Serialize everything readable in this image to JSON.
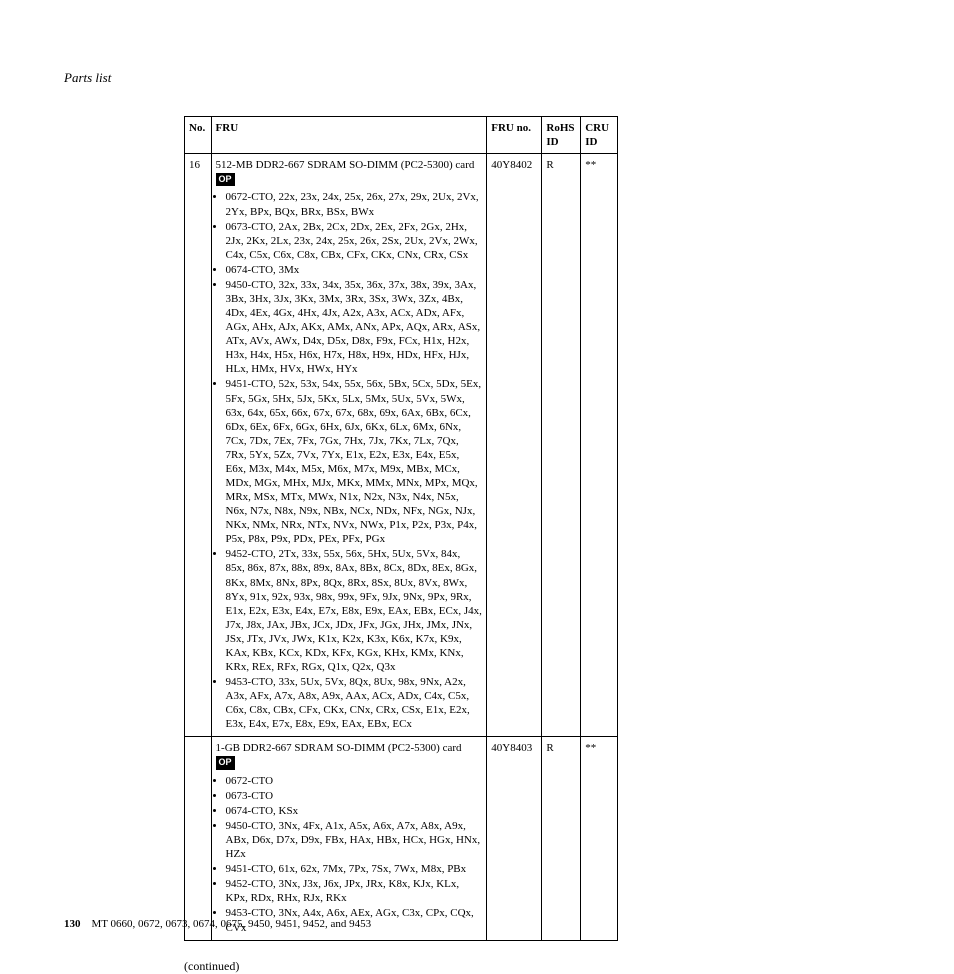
{
  "header": "Parts list",
  "columns": {
    "no": "No.",
    "fru": "FRU",
    "fruno_l1": "FRU no.",
    "rohs_l1": "RoHS",
    "rohs_l2": "ID",
    "cru_l1": "CRU",
    "cru_l2": "ID"
  },
  "rows": [
    {
      "no": "16",
      "title": "512-MB DDR2-667 SDRAM SO-DIMM (PC2-5300) card",
      "op": "OP",
      "bullets": [
        "0672-CTO, 22x, 23x, 24x, 25x, 26x, 27x, 29x, 2Ux, 2Vx, 2Yx, BPx, BQx, BRx, BSx, BWx",
        "0673-CTO, 2Ax, 2Bx, 2Cx, 2Dx, 2Ex, 2Fx, 2Gx, 2Hx, 2Jx, 2Kx, 2Lx, 23x, 24x, 25x, 26x, 2Sx, 2Ux, 2Vx, 2Wx, C4x, C5x, C6x, C8x, CBx, CFx, CKx, CNx, CRx, CSx",
        "0674-CTO, 3Mx",
        "9450-CTO, 32x, 33x, 34x, 35x, 36x, 37x, 38x, 39x, 3Ax, 3Bx, 3Hx, 3Jx, 3Kx, 3Mx, 3Rx, 3Sx, 3Wx, 3Zx, 4Bx, 4Dx, 4Ex, 4Gx, 4Hx, 4Jx, A2x, A3x, ACx, ADx, AFx, AGx, AHx, AJx, AKx, AMx, ANx, APx, AQx, ARx, ASx, ATx, AVx, AWx, D4x, D5x, D8x, F9x, FCx, H1x, H2x, H3x, H4x, H5x, H6x, H7x, H8x, H9x, HDx, HFx, HJx, HLx, HMx, HVx, HWx, HYx",
        "9451-CTO, 52x, 53x, 54x, 55x, 56x, 5Bx, 5Cx, 5Dx, 5Ex, 5Fx, 5Gx, 5Hx, 5Jx, 5Kx, 5Lx, 5Mx, 5Ux, 5Vx, 5Wx, 63x, 64x, 65x, 66x, 67x, 67x, 68x, 69x, 6Ax, 6Bx, 6Cx, 6Dx, 6Ex, 6Fx, 6Gx, 6Hx, 6Jx, 6Kx, 6Lx, 6Mx, 6Nx, 7Cx, 7Dx, 7Ex, 7Fx, 7Gx, 7Hx, 7Jx, 7Kx, 7Lx, 7Qx, 7Rx, 5Yx, 5Zx, 7Vx, 7Yx, E1x, E2x, E3x, E4x, E5x, E6x, M3x, M4x, M5x, M6x, M7x, M9x, MBx, MCx, MDx, MGx, MHx, MJx, MKx, MMx, MNx, MPx, MQx, MRx, MSx, MTx, MWx, N1x, N2x, N3x, N4x, N5x, N6x, N7x, N8x, N9x, NBx, NCx, NDx, NFx, NGx, NJx, NKx, NMx, NRx, NTx, NVx, NWx, P1x, P2x, P3x, P4x, P5x, P8x, P9x, PDx, PEx, PFx, PGx",
        "9452-CTO, 2Tx, 33x, 55x, 56x, 5Hx, 5Ux, 5Vx, 84x, 85x, 86x, 87x, 88x, 89x, 8Ax, 8Bx, 8Cx, 8Dx, 8Ex, 8Gx, 8Kx, 8Mx, 8Nx, 8Px, 8Qx, 8Rx, 8Sx, 8Ux, 8Vx, 8Wx, 8Yx, 91x, 92x, 93x, 98x, 99x, 9Fx, 9Jx, 9Nx, 9Px, 9Rx, E1x, E2x, E3x, E4x, E7x, E8x, E9x, EAx, EBx, ECx, J4x, J7x, J8x, JAx, JBx, JCx, JDx, JFx, JGx, JHx, JMx, JNx, JSx, JTx, JVx, JWx, K1x, K2x, K3x, K6x, K7x, K9x, KAx, KBx, KCx, KDx, KFx, KGx, KHx, KMx, KNx, KRx, REx, RFx, RGx, Q1x, Q2x, Q3x",
        "9453-CTO, 33x, 5Ux, 5Vx, 8Qx, 8Ux, 98x, 9Nx, A2x, A3x, AFx, A7x, A8x, A9x, AAx, ACx, ADx, C4x, C5x, C6x, C8x, CBx, CFx, CKx, CNx, CRx, CSx, E1x, E2x, E3x, E4x, E7x, E8x, E9x, EAx, EBx, ECx"
      ],
      "fruno": "40Y8402",
      "rohs": "R",
      "cru": "**"
    },
    {
      "no": "",
      "title": "1-GB DDR2-667 SDRAM SO-DIMM (PC2-5300) card",
      "op": "OP",
      "bullets": [
        "0672-CTO",
        "0673-CTO",
        "0674-CTO, KSx",
        "9450-CTO, 3Nx, 4Fx, A1x, A5x, A6x, A7x, A8x, A9x, ABx, D6x, D7x, D9x, FBx, HAx, HBx, HCx, HGx, HNx, HZx",
        "9451-CTO, 61x, 62x, 7Mx, 7Px, 7Sx, 7Wx, M8x, PBx",
        "9452-CTO, 3Nx, J3x, J6x, JPx, JRx, K8x, KJx, KLx, KPx, RDx, RHx, RJx, RKx",
        "9453-CTO, 3Nx, A4x, A6x, AEx, AGx, C3x, CPx, CQx, CVx"
      ],
      "fruno": "40Y8403",
      "rohs": "R",
      "cru": "**"
    }
  ],
  "continued": "(continued)",
  "footer": {
    "page": "130",
    "text": "MT 0660, 0672, 0673, 0674, 0675, 9450, 9451, 9452, and 9453"
  }
}
